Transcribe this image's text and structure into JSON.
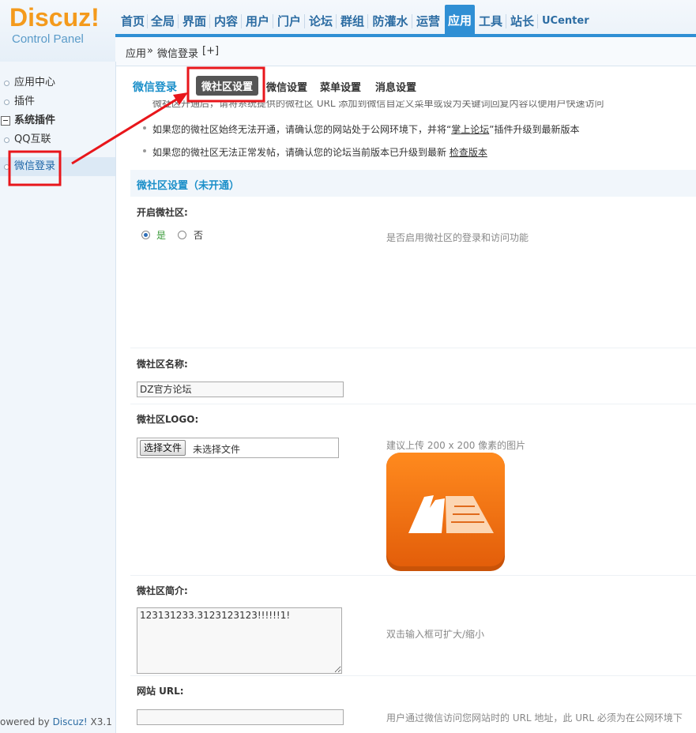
{
  "brand": {
    "name": "Discuz!",
    "subtitle": "Control Panel"
  },
  "nav": {
    "items": [
      {
        "label": "首页"
      },
      {
        "label": "全局"
      },
      {
        "label": "界面"
      },
      {
        "label": "内容"
      },
      {
        "label": "用户"
      },
      {
        "label": "门户"
      },
      {
        "label": "论坛"
      },
      {
        "label": "群组"
      },
      {
        "label": "防灌水"
      },
      {
        "label": "运营"
      },
      {
        "label": "应用",
        "active": true
      },
      {
        "label": "工具"
      },
      {
        "label": "站长"
      },
      {
        "label": "UCenter"
      }
    ]
  },
  "breadcrumb": {
    "root": "应用",
    "sep": "»",
    "current": "微信登录",
    "add": "[+]"
  },
  "sidebar": {
    "items": [
      {
        "label": "应用中心"
      },
      {
        "label": "插件"
      },
      {
        "label": "系统插件"
      },
      {
        "label": "QQ互联"
      },
      {
        "label": "微信登录"
      }
    ],
    "footer_prefix": "owered by ",
    "footer_brand": "Discuz!",
    "footer_version": " X3.1"
  },
  "tabs": {
    "title": "微信登录",
    "items": [
      "微社区设置",
      "微信设置",
      "菜单设置",
      "消息设置"
    ]
  },
  "tips": {
    "line0": "微社区开通后，请将系统提供的微社区 URL 添加到微信自定义菜单或设为关键词回复内容以便用户快速访问",
    "line1_a": "如果您的微社区始终无法开通，请确认您的网站处于公网环境下，并将“",
    "line1_link": "掌上论坛",
    "line1_b": "”插件升级到最新版本",
    "line2_a": "如果您的微社区无法正常发帖，请确认您的论坛当前版本已升级到最新 ",
    "line2_link": "检查版本"
  },
  "section": {
    "title": "微社区设置（未开通）"
  },
  "form": {
    "enable_label": "开启微社区:",
    "enable_yes": "是",
    "enable_no": "否",
    "enable_hint": "是否启用微社区的登录和访问功能",
    "name_label": "微社区名称:",
    "name_value": "DZ官方论坛",
    "logo_label": "微社区LOGO:",
    "logo_button": "选择文件",
    "logo_nofile": "未选择文件",
    "logo_hint": "建议上传 200 x 200 像素的图片",
    "intro_label": "微社区简介:",
    "intro_value": "123131233.3123123123!!!!!!1!",
    "intro_hint": "双击输入框可扩大/缩小",
    "url_label": "网站 URL:",
    "url_value": "",
    "url_hint": "用户通过微信访问您网站时的 URL 地址，此 URL 必须为在公网环境下"
  },
  "colors": {
    "accent": "#2f8fd4",
    "brand_orange": "#f49a1c",
    "link_blue": "#1b8fc9",
    "annotation_red": "#e8161b"
  }
}
